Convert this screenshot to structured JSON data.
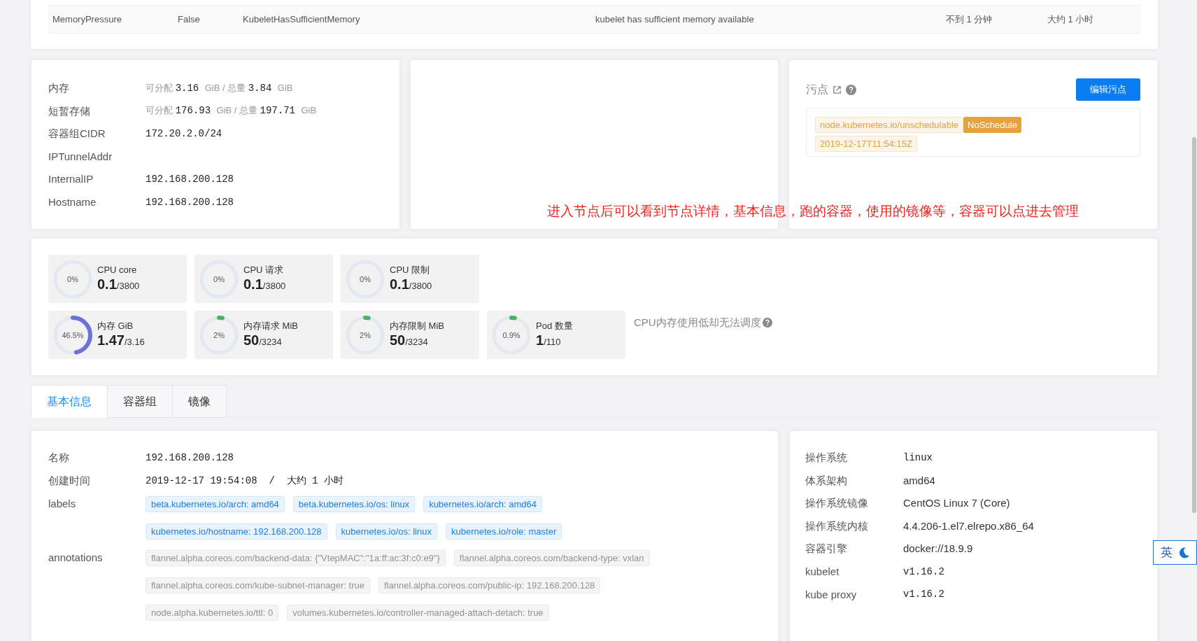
{
  "conditions": [
    {
      "type": "MemoryPressure",
      "status": "False",
      "reason": "KubeletHasSufficientMemory",
      "message": "kubelet has sufficient memory available",
      "last_heartbeat": "不到 1 分钟",
      "last_transition": "大约 1 小时"
    }
  ],
  "resources": [
    {
      "label": "内存",
      "kind": "resource",
      "parts": [
        {
          "text": "可分配",
          "kind": "note"
        },
        {
          "text": "3.16",
          "kind": "num"
        },
        {
          "text": "GiB / 总量",
          "kind": "note"
        },
        {
          "text": "3.84",
          "kind": "num"
        },
        {
          "text": "GiB",
          "kind": "note"
        }
      ]
    },
    {
      "label": "短暂存储",
      "kind": "resource",
      "parts": [
        {
          "text": "可分配",
          "kind": "note"
        },
        {
          "text": "176.93",
          "kind": "num"
        },
        {
          "text": "GiB / 总量",
          "kind": "note"
        },
        {
          "text": "197.71",
          "kind": "num"
        },
        {
          "text": "GiB",
          "kind": "note"
        }
      ]
    },
    {
      "label": "容器组CIDR",
      "kind": "mono",
      "value": "172.20.2.0/24"
    },
    {
      "label": "IPTunnelAddr",
      "kind": "mono"
    },
    {
      "label": "InternalIP",
      "kind": "mono",
      "value": "192.168.200.128"
    },
    {
      "label": "Hostname",
      "kind": "mono",
      "value": "192.168.200.128"
    }
  ],
  "taints": {
    "title": "污点",
    "button": "编辑污点",
    "items": [
      {
        "key": "node.kubernetes.io/unschedulable",
        "effect": "NoSchedule",
        "time": "2019-12-17T11:54:15Z"
      }
    ]
  },
  "annotation_note": "进入节点后可以看到节点详情，基本信息，跑的容器，使用的镜像等，容器可以点进去管理",
  "gauges": [
    [
      {
        "label": "CPU core",
        "percent": "0%",
        "value": "0.1",
        "total": "/3800",
        "level": 0
      },
      {
        "label": "CPU 请求",
        "percent": "0%",
        "value": "0.1",
        "total": "/3800",
        "level": 0
      },
      {
        "label": "CPU 限制",
        "percent": "0%",
        "value": "0.1",
        "total": "/3800",
        "level": 0
      }
    ],
    [
      {
        "label": "内存 GiB",
        "percent": "46.5%",
        "value": "1.47",
        "total": "/3.16",
        "level": 0.465,
        "color": "#6b72d8"
      },
      {
        "label": "内存请求 MiB",
        "percent": "2%",
        "value": "50",
        "total": "/3234",
        "level": 0.02
      },
      {
        "label": "内存限制 MiB",
        "percent": "2%",
        "value": "50",
        "total": "/3234",
        "level": 0.02
      },
      {
        "label": "Pod 数量",
        "percent": "0.9%",
        "value": "1",
        "total": "/110",
        "level": 0.009
      }
    ]
  ],
  "gauge_note": "CPU内存使用低却无法调度",
  "tabs": [
    {
      "label": "基本信息",
      "selected": true
    },
    {
      "label": "容器组",
      "selected": false
    },
    {
      "label": "镜像",
      "selected": false
    }
  ],
  "basic": [
    {
      "label": "名称",
      "kind": "mono",
      "value": "192.168.200.128"
    },
    {
      "label": "创建时间",
      "kind": "mono",
      "value": "2019-12-17 19:54:08  /  大约 1 小时"
    },
    {
      "label": "labels",
      "kind": "labels",
      "tags": [
        "beta.kubernetes.io/arch: amd64",
        "beta.kubernetes.io/os: linux",
        "kubernetes.io/arch: amd64",
        "kubernetes.io/hostname: 192.168.200.128",
        "kubernetes.io/os: linux",
        "kubernetes.io/role: master"
      ]
    },
    {
      "label": "annotations",
      "kind": "annotations",
      "tags": [
        "flannel.alpha.coreos.com/backend-data: {\"VtepMAC\":\"1a:ff:ac:3f:c0:e9\"}",
        "flannel.alpha.coreos.com/backend-type: vxlan",
        "flannel.alpha.coreos.com/kube-subnet-manager: true",
        "flannel.alpha.coreos.com/public-ip: 192.168.200.128",
        "node.alpha.kubernetes.io/ttl: 0",
        "volumes.kubernetes.io/controller-managed-attach-detach: true"
      ]
    }
  ],
  "system": [
    {
      "label": "操作系统",
      "kind": "mono",
      "value": "linux"
    },
    {
      "label": "体系架构",
      "kind": "text",
      "value": "amd64"
    },
    {
      "label": "操作系统镜像",
      "kind": "text",
      "value": "CentOS Linux 7 (Core)"
    },
    {
      "label": "操作系统内核",
      "kind": "text",
      "value": "4.4.206-1.el7.elrepo.x86_64"
    },
    {
      "label": "容器引擎",
      "kind": "text",
      "value": "docker://18.9.9"
    },
    {
      "label": "kubelet",
      "kind": "mono",
      "value": "v1.16.2"
    },
    {
      "label": "kube proxy",
      "kind": "mono",
      "value": "v1.16.2"
    }
  ],
  "ime": {
    "label": "英"
  }
}
